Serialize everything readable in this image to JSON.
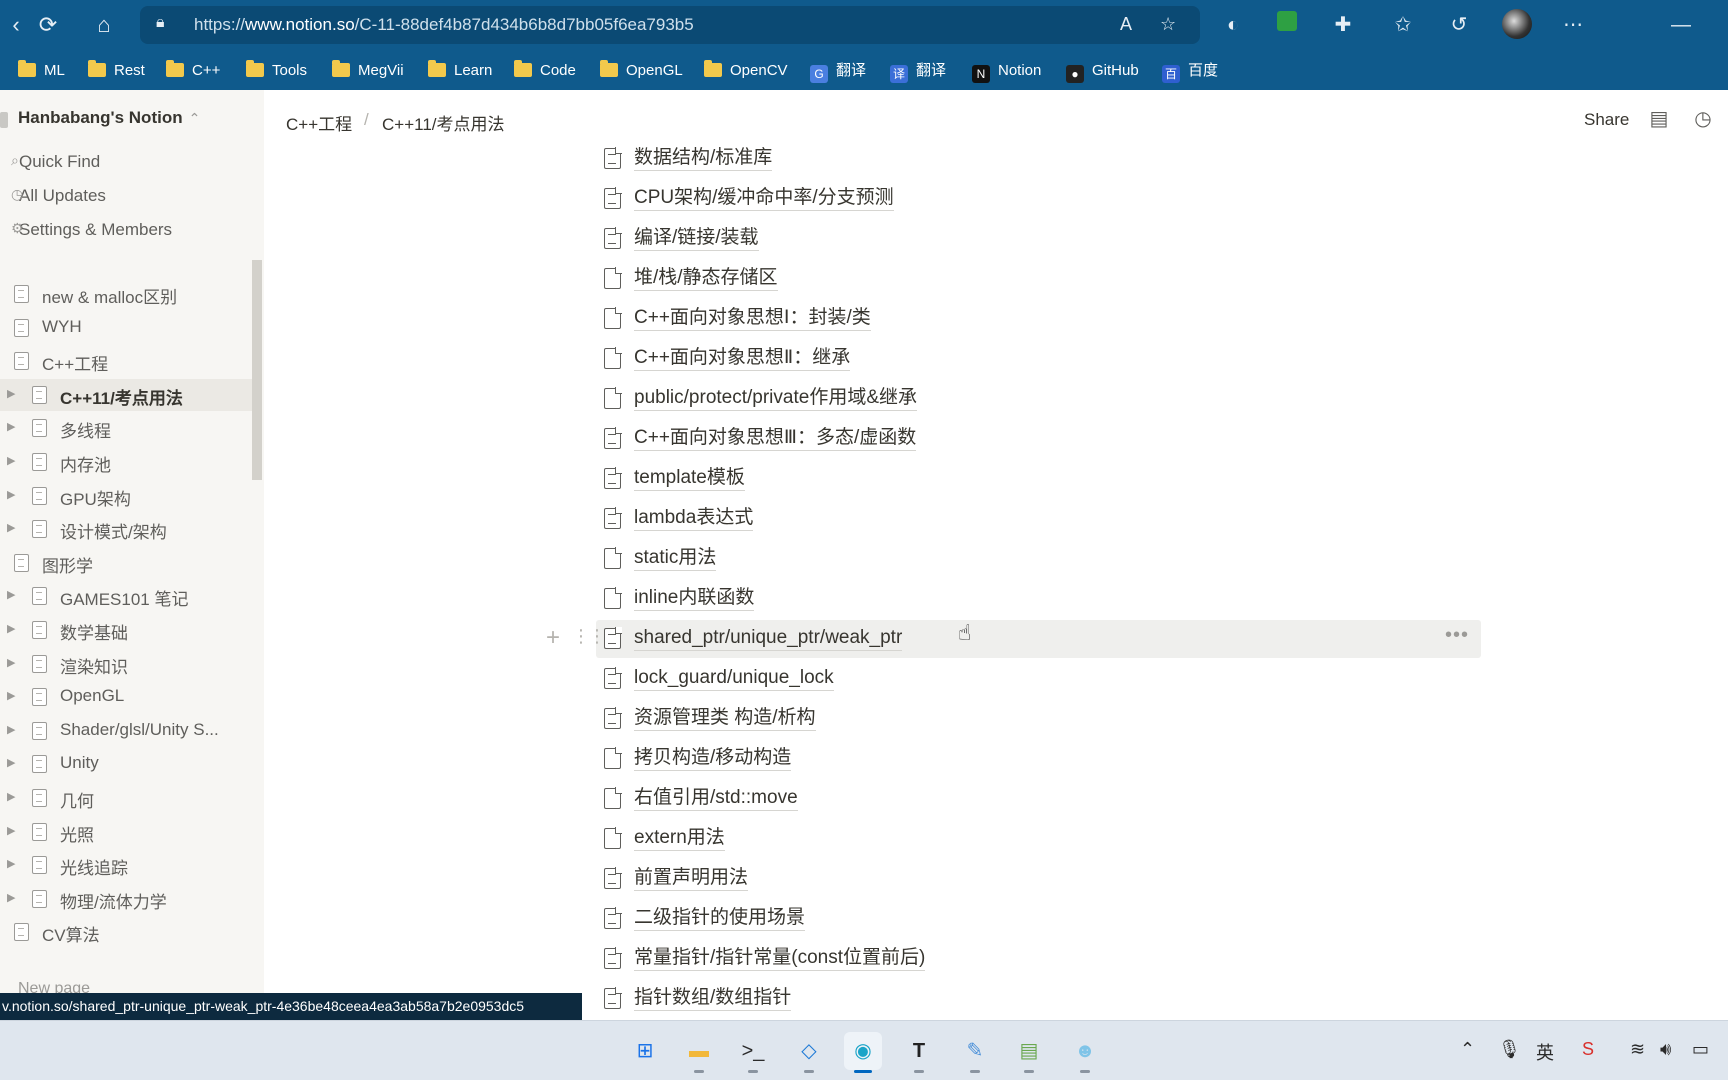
{
  "browser": {
    "url_prefix": "https://",
    "url_domain": "www.notion.so",
    "url_path": "/C-11-88def4b87d434b6b8d7bb05f6ea793b5",
    "bookmarks": [
      {
        "label": "ML",
        "type": "folder"
      },
      {
        "label": "Rest",
        "type": "folder"
      },
      {
        "label": "C++",
        "type": "folder"
      },
      {
        "label": "Tools",
        "type": "folder"
      },
      {
        "label": "MegVii",
        "type": "folder"
      },
      {
        "label": "Learn",
        "type": "folder"
      },
      {
        "label": "Code",
        "type": "folder"
      },
      {
        "label": "OpenGL",
        "type": "folder"
      },
      {
        "label": "OpenCV",
        "type": "folder"
      },
      {
        "label": "翻译",
        "type": "google-translate-icon"
      },
      {
        "label": "翻译",
        "type": "translate-icon"
      },
      {
        "label": "Notion",
        "type": "notion-icon"
      },
      {
        "label": "GitHub",
        "type": "github-icon"
      },
      {
        "label": "百度",
        "type": "baidu-icon"
      }
    ]
  },
  "sidebar": {
    "workspace": "Hanbabang's Notion",
    "links": [
      "Quick Find",
      "All Updates",
      "Settings & Members"
    ],
    "tree": [
      {
        "label": "new & malloc区别",
        "depth": 0,
        "arrow": false,
        "active": false
      },
      {
        "label": "WYH",
        "depth": 0,
        "arrow": false,
        "active": false
      },
      {
        "label": "C++工程",
        "depth": 0,
        "arrow": false,
        "active": false
      },
      {
        "label": "C++11/考点用法",
        "depth": 1,
        "arrow": true,
        "active": true
      },
      {
        "label": "多线程",
        "depth": 1,
        "arrow": true,
        "active": false
      },
      {
        "label": "内存池",
        "depth": 1,
        "arrow": true,
        "active": false
      },
      {
        "label": "GPU架构",
        "depth": 1,
        "arrow": true,
        "active": false
      },
      {
        "label": "设计模式/架构",
        "depth": 1,
        "arrow": true,
        "active": false
      },
      {
        "label": "图形学",
        "depth": 0,
        "arrow": false,
        "active": false
      },
      {
        "label": "GAMES101 笔记",
        "depth": 1,
        "arrow": true,
        "active": false
      },
      {
        "label": "数学基础",
        "depth": 1,
        "arrow": true,
        "active": false
      },
      {
        "label": "渲染知识",
        "depth": 1,
        "arrow": true,
        "active": false
      },
      {
        "label": "OpenGL",
        "depth": 1,
        "arrow": true,
        "active": false
      },
      {
        "label": "Shader/glsl/Unity S...",
        "depth": 1,
        "arrow": true,
        "active": false
      },
      {
        "label": "Unity",
        "depth": 1,
        "arrow": true,
        "active": false
      },
      {
        "label": "几何",
        "depth": 1,
        "arrow": true,
        "active": false
      },
      {
        "label": "光照",
        "depth": 1,
        "arrow": true,
        "active": false
      },
      {
        "label": "光线追踪",
        "depth": 1,
        "arrow": true,
        "active": false
      },
      {
        "label": "物理/流体力学",
        "depth": 1,
        "arrow": true,
        "active": false
      },
      {
        "label": "CV算法",
        "depth": 0,
        "arrow": false,
        "active": false
      }
    ],
    "new_page": "New page"
  },
  "breadcrumb": [
    "C++工程",
    "C++11/考点用法"
  ],
  "topbar": {
    "share": "Share"
  },
  "pages": [
    {
      "label": "数据结构/标准库",
      "lines": true
    },
    {
      "label": "CPU架构/缓冲命中率/分支预测",
      "lines": true
    },
    {
      "label": "编译/链接/装载",
      "lines": true
    },
    {
      "label": "堆/栈/静态存储区",
      "lines": false
    },
    {
      "label": "C++面向对象思想Ⅰ：封装/类",
      "lines": false
    },
    {
      "label": "C++面向对象思想Ⅱ：继承",
      "lines": false
    },
    {
      "label": "public/protect/private作用域&继承",
      "lines": false
    },
    {
      "label": "C++面向对象思想Ⅲ：多态/虚函数",
      "lines": true
    },
    {
      "label": "template模板",
      "lines": true
    },
    {
      "label": "lambda表达式",
      "lines": true
    },
    {
      "label": "static用法",
      "lines": false
    },
    {
      "label": "inline内联函数",
      "lines": false
    },
    {
      "label": "shared_ptr/unique_ptr/weak_ptr",
      "lines": true
    },
    {
      "label": "lock_guard/unique_lock",
      "lines": true
    },
    {
      "label": "资源管理类 构造/析构",
      "lines": true
    },
    {
      "label": "拷贝构造/移动构造",
      "lines": false
    },
    {
      "label": "右值引用/std::move",
      "lines": false
    },
    {
      "label": "extern用法",
      "lines": false
    },
    {
      "label": "前置声明用法",
      "lines": true
    },
    {
      "label": "二级指针的使用场景",
      "lines": true
    },
    {
      "label": "常量指针/指针常量(const位置前后)",
      "lines": true
    },
    {
      "label": "指针数组/数组指针",
      "lines": true
    }
  ],
  "hovered_index": 12,
  "status_url": "v.notion.so/shared_ptr-unique_ptr-weak_ptr-4e36be48ceea4ea3ab58a7b2e0953dc5",
  "taskbar": {
    "apps": [
      {
        "name": "start-icon",
        "color": "#1a73e8"
      },
      {
        "name": "file-explorer-icon",
        "color": "#f2b83a"
      },
      {
        "name": "terminal-icon",
        "color": "#2b2b2b"
      },
      {
        "name": "vscode-icon",
        "color": "#1e7ad6"
      },
      {
        "name": "edge-icon",
        "color": "#1aa4c8"
      },
      {
        "name": "typora-icon",
        "color": "#ffffff"
      },
      {
        "name": "drawing-app-icon",
        "color": "#4a90d9"
      },
      {
        "name": "chart-app-icon",
        "color": "#6aa84f"
      },
      {
        "name": "game-app-icon",
        "color": "#7fc4e8"
      }
    ],
    "ime": "英"
  }
}
